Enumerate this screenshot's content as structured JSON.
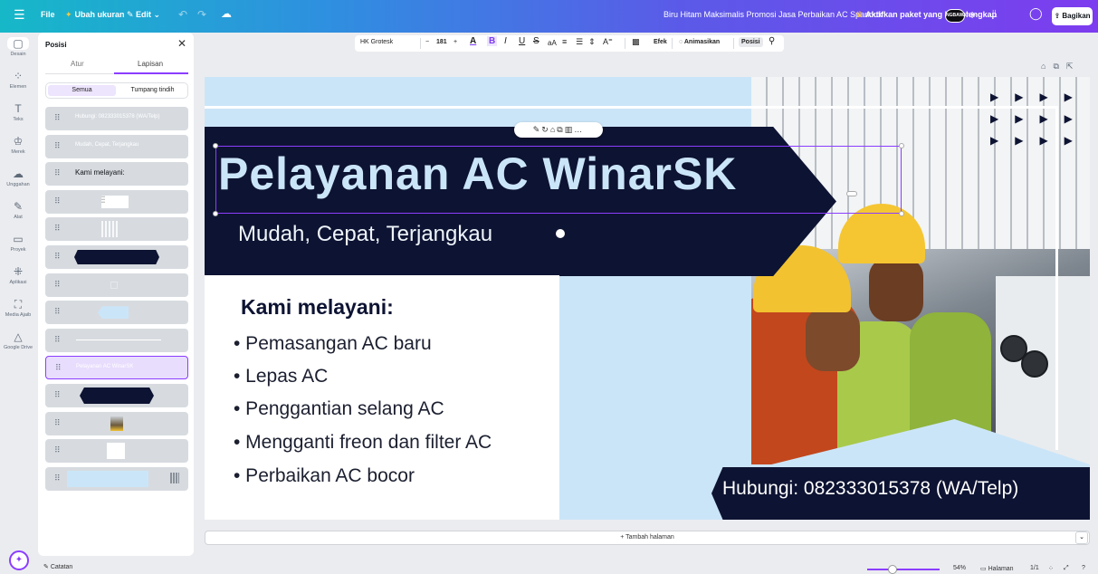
{
  "topbar": {
    "menu_icon": "hamburger-icon",
    "file_label": "File",
    "resize_label": "Ubah ukuran",
    "edit_label": "Edit",
    "design_title": "Biru Hitam Maksimalis Promosi Jasa Perbaikan AC Spanduk",
    "upgrade_label": "Aktifkan paket yang lebih lengkap",
    "avatar_text": "NGBAWAT",
    "share_label": "Bagikan"
  },
  "rail": {
    "items": [
      {
        "label": "Desain",
        "icon": "layout-icon",
        "glyph": "▢"
      },
      {
        "label": "Elemen",
        "icon": "shapes-icon",
        "glyph": "⁘"
      },
      {
        "label": "Teks",
        "icon": "text-icon",
        "glyph": "T"
      },
      {
        "label": "Merek",
        "icon": "brand-icon",
        "glyph": "♔"
      },
      {
        "label": "Unggahan",
        "icon": "upload-icon",
        "glyph": "☁"
      },
      {
        "label": "Alat",
        "icon": "draw-icon",
        "glyph": "✎"
      },
      {
        "label": "Proyek",
        "icon": "folder-icon",
        "glyph": "▭"
      },
      {
        "label": "Aplikasi",
        "icon": "apps-icon",
        "glyph": "⁜"
      },
      {
        "label": "Media Ajaib",
        "icon": "magic-media-icon",
        "glyph": "⛶"
      },
      {
        "label": "Google Drive",
        "icon": "google-drive-icon",
        "glyph": "△"
      }
    ]
  },
  "panel": {
    "title": "Posisi",
    "tabs": [
      "Atur",
      "Lapisan"
    ],
    "filters": [
      "Semua",
      "Tumpang tindih"
    ],
    "layers": [
      {
        "text": "Hubungi: 082333015378 (WA/Telp)"
      },
      {
        "text": "Mudah, Cepat, Terjangkau"
      },
      {
        "text": "Kami melayani:"
      },
      {
        "text": ""
      },
      {
        "text": ""
      },
      {
        "text": ""
      },
      {
        "text": ""
      },
      {
        "text": ""
      },
      {
        "text": ""
      },
      {
        "text": "Pelayanan AC WinarSK"
      },
      {
        "text": ""
      },
      {
        "text": ""
      },
      {
        "text": ""
      },
      {
        "text": ""
      }
    ]
  },
  "notes_label": "Catatan",
  "format_toolbar": {
    "font": "HK Grotesk",
    "size": "181",
    "effects_label": "Efek",
    "animate_label": "Animasikan",
    "position_label": "Posisi"
  },
  "design": {
    "headline": "Pelayanan AC WinarSK",
    "subheadline": "Mudah, Cepat, Terjangkau",
    "services_title": "Kami melayani:",
    "services": [
      "• Pemasangan AC baru",
      "• Lepas AC",
      "• Penggantian selang AC",
      "• Mengganti freon dan filter AC",
      "• Perbaikan AC bocor"
    ],
    "contact": "Hubungi: 082333015378 (WA/Telp)",
    "colors": {
      "navy": "#0d1332",
      "light_blue": "#cbe5f8",
      "accent": "#8b3dff"
    }
  },
  "bottom": {
    "add_page_label": "+ Tambah halaman",
    "zoom": "54%",
    "pages_label": "Halaman",
    "page_count": "1/1"
  }
}
